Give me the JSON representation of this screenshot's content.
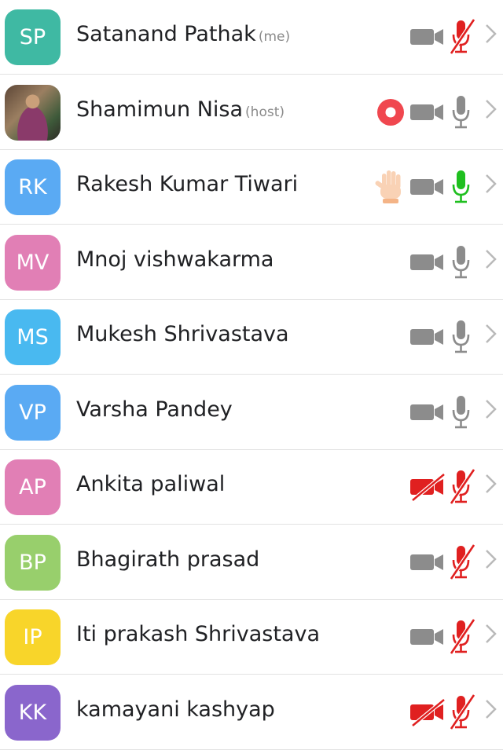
{
  "colors": {
    "muted_red": "#e02020",
    "icon_gray": "#8c8c8c",
    "active_green": "#1fbf1f",
    "record_red": "#f0474f"
  },
  "participants": [
    {
      "initials": "SP",
      "name": "Satanand Pathak",
      "tag": "(me)",
      "avatar_color": "#3fb9a3",
      "video": "on",
      "mic": "muted",
      "extra": null
    },
    {
      "initials": "",
      "name": "Shamimun Nisa",
      "tag": "(host)",
      "avatar_color": "photo",
      "video": "on",
      "mic": "on",
      "extra": "record-icon"
    },
    {
      "initials": "RK",
      "name": "Rakesh Kumar Tiwari",
      "tag": "",
      "avatar_color": "#5aaaf3",
      "video": "on",
      "mic": "speaking",
      "extra": "raised-hand-icon"
    },
    {
      "initials": "MV",
      "name": "Mnoj vishwakarma",
      "tag": "",
      "avatar_color": "#e17fb5",
      "video": "on",
      "mic": "on",
      "extra": null
    },
    {
      "initials": "MS",
      "name": "Mukesh Shrivastava",
      "tag": "",
      "avatar_color": "#49b9f0",
      "video": "on",
      "mic": "on",
      "extra": null
    },
    {
      "initials": "VP",
      "name": "Varsha Pandey",
      "tag": "",
      "avatar_color": "#5aaaf3",
      "video": "on",
      "mic": "on",
      "extra": null
    },
    {
      "initials": "AP",
      "name": "Ankita paliwal",
      "tag": "",
      "avatar_color": "#e17fb5",
      "video": "off",
      "mic": "muted",
      "extra": null
    },
    {
      "initials": "BP",
      "name": "Bhagirath prasad",
      "tag": "",
      "avatar_color": "#98cf6c",
      "video": "on",
      "mic": "muted",
      "extra": null
    },
    {
      "initials": "IP",
      "name": "Iti prakash Shrivastava",
      "tag": "",
      "avatar_color": "#f8d52a",
      "video": "on",
      "mic": "muted",
      "extra": null
    },
    {
      "initials": "KK",
      "name": "kamayani kashyap",
      "tag": "",
      "avatar_color": "#8a66cc",
      "video": "off",
      "mic": "muted",
      "extra": null
    }
  ]
}
